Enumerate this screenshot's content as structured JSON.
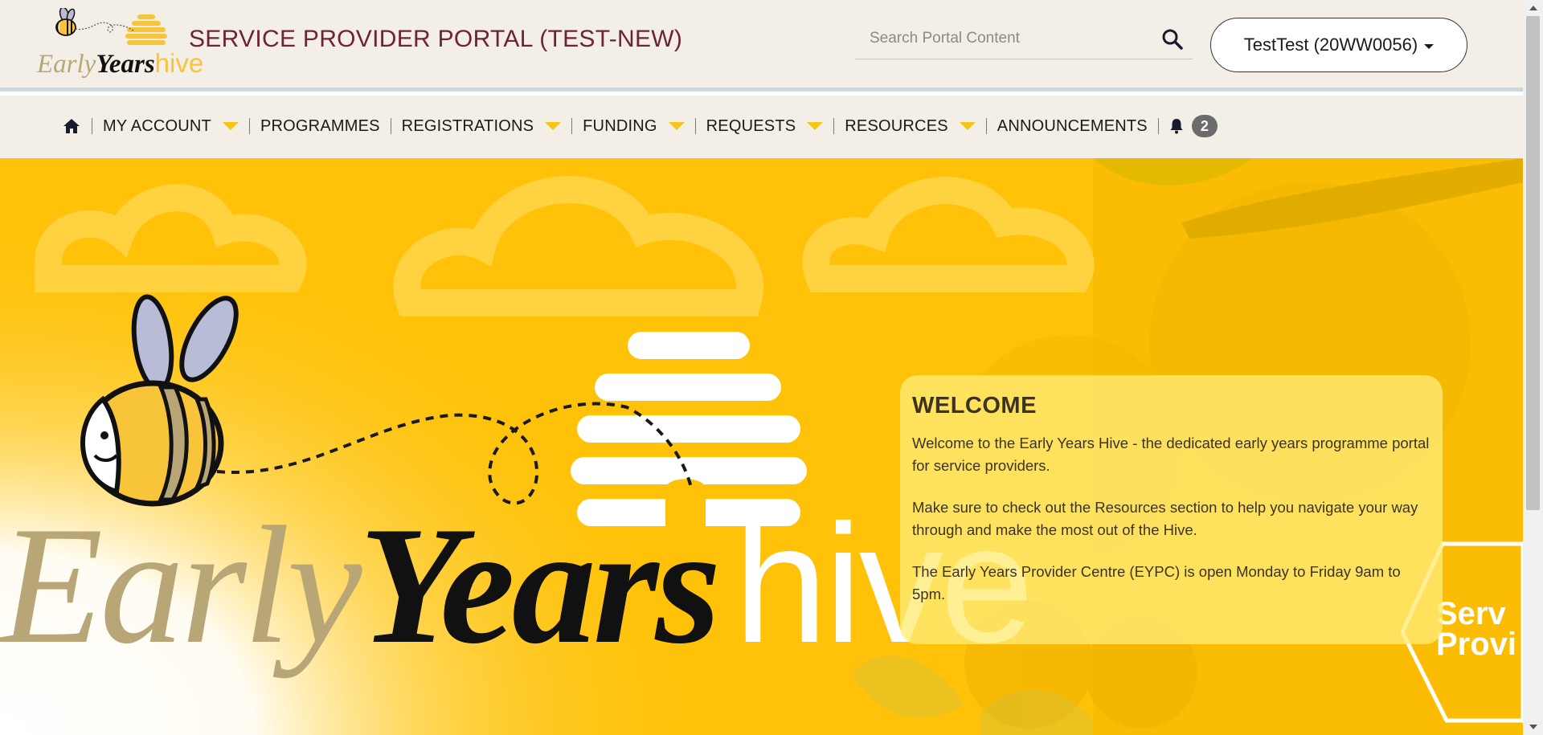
{
  "header": {
    "logo_text_early": "Early",
    "logo_text_years": "Years",
    "logo_text_hive": "hive",
    "portal_title": "SERVICE PROVIDER PORTAL (TEST-NEW)",
    "search": {
      "placeholder": "Search Portal Content",
      "value": ""
    },
    "user_label": "TestTest (20WW0056)"
  },
  "nav": {
    "items": [
      {
        "label": "MY ACCOUNT",
        "has_dropdown": true
      },
      {
        "label": "PROGRAMMES",
        "has_dropdown": false
      },
      {
        "label": "REGISTRATIONS",
        "has_dropdown": true
      },
      {
        "label": "FUNDING",
        "has_dropdown": true
      },
      {
        "label": "REQUESTS",
        "has_dropdown": true
      },
      {
        "label": "RESOURCES",
        "has_dropdown": true
      },
      {
        "label": "ANNOUNCEMENTS",
        "has_dropdown": false
      }
    ],
    "notification_count": "2"
  },
  "hero": {
    "brand_early": "Early",
    "brand_years": "Years",
    "brand_hive": "hive",
    "badge_text_line1": "Serv",
    "badge_text_line2": "Provi"
  },
  "welcome": {
    "title": "WELCOME",
    "paragraphs": [
      "Welcome to the Early Years Hive - the dedicated early years programme portal for service providers.",
      "Make sure to check out the Resources section to help you navigate your way through and make the most out of the Hive.",
      "The Early Years Provider Centre (EYPC) is open Monday to Friday 9am to 5pm."
    ]
  },
  "colors": {
    "brand_yellow": "#ffc208",
    "title_maroon": "#6e2437",
    "nav_caret": "#f5c518",
    "header_bg": "#f3efe6"
  },
  "icons": {
    "home": "home-icon",
    "search": "search-icon",
    "bell": "bell-icon"
  }
}
